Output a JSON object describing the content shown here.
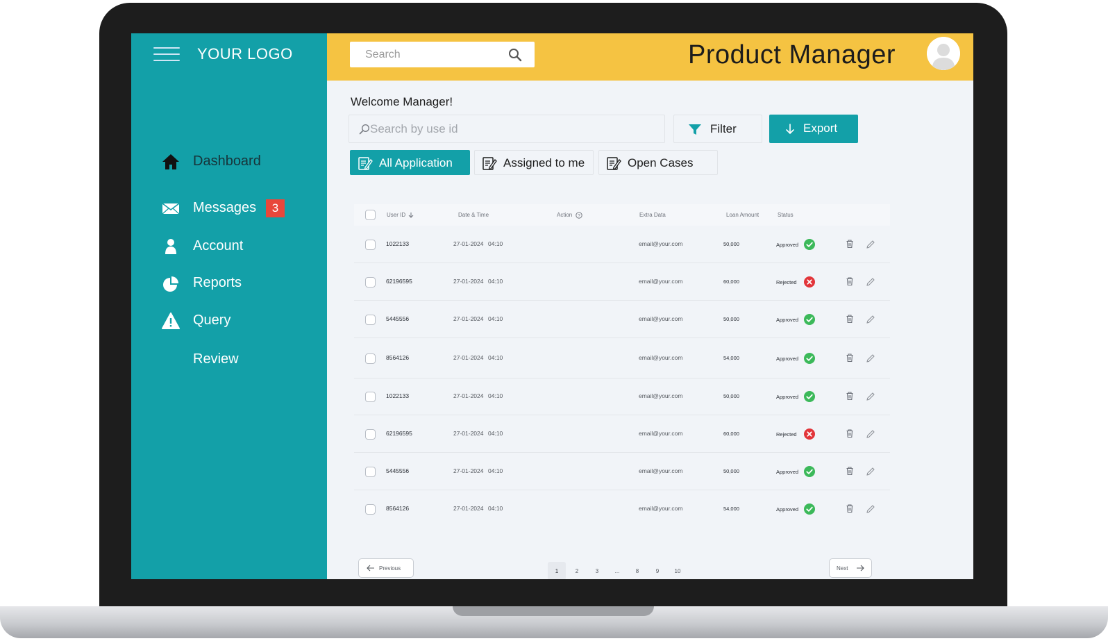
{
  "sidebar": {
    "logo": "YOUR LOGO",
    "items": [
      {
        "label": "Dashboard",
        "icon": "home-icon"
      },
      {
        "label": "Messages",
        "icon": "envelope-icon",
        "badge": "3"
      },
      {
        "label": "Account",
        "icon": "user-icon"
      },
      {
        "label": "Reports",
        "icon": "pie-chart-icon"
      },
      {
        "label": "Query",
        "icon": "warning-icon"
      },
      {
        "label": "Review",
        "icon": ""
      }
    ]
  },
  "header": {
    "search_placeholder": "Search",
    "title": "Product Manager"
  },
  "main": {
    "welcome": "Welcome Manager!",
    "id_search_placeholder": "Search by use id",
    "filter_label": "Filter",
    "export_label": "Export",
    "tabs": [
      {
        "label": "All Application",
        "active": true
      },
      {
        "label": "Assigned to me",
        "active": false
      },
      {
        "label": "Open Cases",
        "active": false
      }
    ]
  },
  "table": {
    "columns": [
      "User ID",
      "Date & Time",
      "Action",
      "Extra Data",
      "Loan Amount",
      "Status"
    ],
    "rows": [
      {
        "user_id": "1022133",
        "date": "27-01-2024",
        "time": "04:10",
        "extra": "email@your.com",
        "amount": "50,000",
        "status": "Approved"
      },
      {
        "user_id": "62196595",
        "date": "27-01-2024",
        "time": "04:10",
        "extra": "email@your.com",
        "amount": "60,000",
        "status": "Rejected"
      },
      {
        "user_id": "5445556",
        "date": "27-01-2024",
        "time": "04:10",
        "extra": "email@your.com",
        "amount": "50,000",
        "status": "Approved"
      },
      {
        "user_id": "8564126",
        "date": "27-01-2024",
        "time": "04:10",
        "extra": "email@your.com",
        "amount": "54,000",
        "status": "Approved"
      },
      {
        "user_id": "1022133",
        "date": "27-01-2024",
        "time": "04:10",
        "extra": "email@your.com",
        "amount": "50,000",
        "status": "Approved"
      },
      {
        "user_id": "62196595",
        "date": "27-01-2024",
        "time": "04:10",
        "extra": "email@your.com",
        "amount": "60,000",
        "status": "Rejected"
      },
      {
        "user_id": "5445556",
        "date": "27-01-2024",
        "time": "04:10",
        "extra": "email@your.com",
        "amount": "50,000",
        "status": "Approved"
      },
      {
        "user_id": "8564126",
        "date": "27-01-2024",
        "time": "04:10",
        "extra": "email@your.com",
        "amount": "54,000",
        "status": "Approved"
      }
    ]
  },
  "pagination": {
    "previous": "Previous",
    "next": "Next",
    "pages": [
      "1",
      "2",
      "3",
      "...",
      "8",
      "9",
      "10"
    ],
    "current": "1"
  },
  "colors": {
    "teal": "#13a0a8",
    "yellow": "#f5c342",
    "approved": "#3cb95a",
    "rejected": "#e2353a",
    "badge": "#e8473b"
  }
}
